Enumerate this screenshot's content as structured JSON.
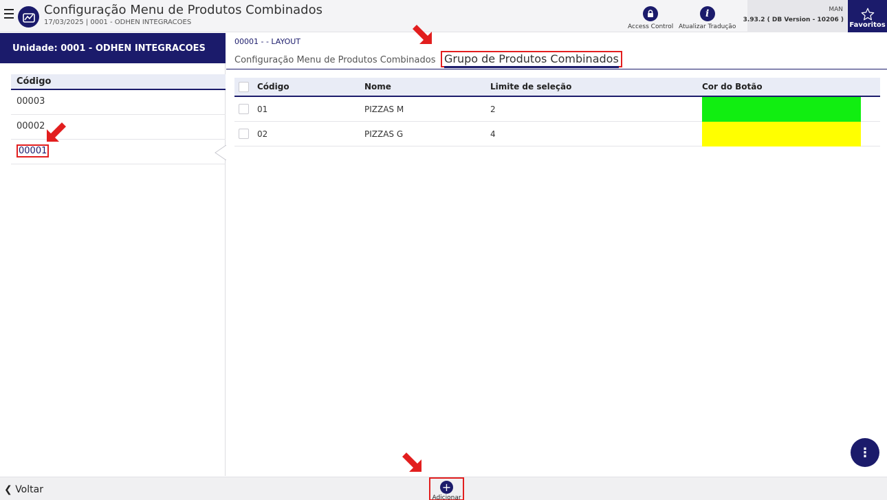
{
  "header": {
    "title": "Configuração Menu de Produtos Combinados",
    "subtitle": "17/03/2025 | 0001 - ODHEN INTEGRACOES",
    "actions": [
      {
        "label": "Access Control",
        "icon": "lock-icon"
      },
      {
        "label": "Atualizar Tradução",
        "icon": "info-icon"
      }
    ],
    "user": "MAN",
    "version": "3.93.2 ( DB Version - 10206 )",
    "favorites_label": "Favoritos",
    "brand_color": "#1b1b6b"
  },
  "left_panel": {
    "unit": "Unidade: 0001 - ODHEN INTEGRACOES",
    "column_header": "Código",
    "items": [
      "00003",
      "00002",
      "00001"
    ],
    "selected": "00001"
  },
  "content": {
    "breadcrumb": "00001 - - LAYOUT",
    "tabs": [
      "Configuração Menu de Produtos Combinados",
      "Grupo de Produtos Combinados"
    ],
    "active_tab": "Grupo de Produtos Combinados",
    "table": {
      "headers": [
        "Código",
        "Nome",
        "Limite de seleção",
        "Cor do Botão"
      ],
      "rows": [
        {
          "codigo": "01",
          "nome": "PIZZAS M",
          "limite": "2",
          "cor": "#11ee11"
        },
        {
          "codigo": "02",
          "nome": "PIZZAS G",
          "limite": "4",
          "cor": "#ffff00"
        }
      ]
    }
  },
  "footer": {
    "back_label": "Voltar",
    "add_label": "Adicionar"
  },
  "annotation_color": "#e21e1e"
}
